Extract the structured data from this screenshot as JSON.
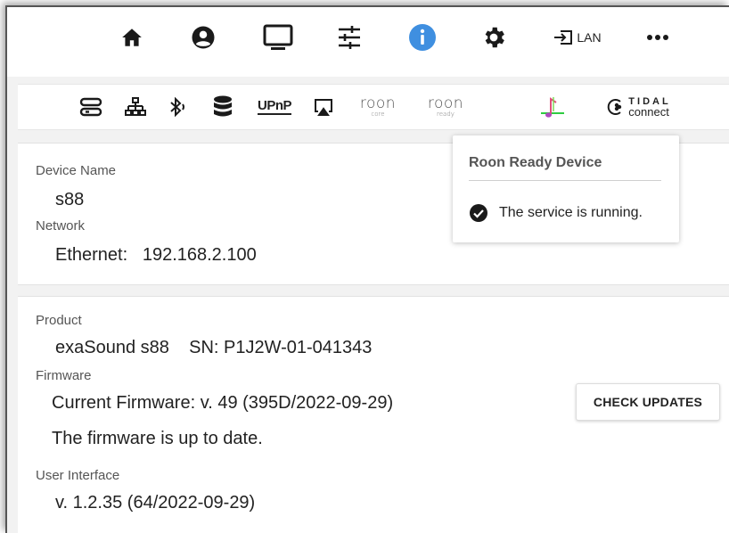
{
  "nav": {
    "icons": [
      "home-icon",
      "account-icon",
      "monitor-icon",
      "tune-icon",
      "info-icon",
      "gear-icon",
      "input-icon",
      "more-icon"
    ],
    "lan_label": "LAN",
    "accent": "#3f8fe0"
  },
  "services": {
    "upnp": "UPnP",
    "roon_core": {
      "main": "roon",
      "sub": "core"
    },
    "roon_ready": {
      "main": "roon",
      "sub": "ready"
    },
    "tidal": {
      "top": "TIDAL",
      "bottom": "connect"
    }
  },
  "device": {
    "name_label": "Device Name",
    "name_value": "s88",
    "network_label": "Network",
    "network_value": "Ethernet:   192.168.2.100"
  },
  "product": {
    "product_label": "Product",
    "product_value": "exaSound s88    SN: P1J2W-01-041343",
    "firmware_label": "Firmware",
    "firmware_current": "Current Firmware: v. 49 (395D/2022-09-29)",
    "firmware_status": "The firmware is up to date.",
    "check_button": "CHECK UPDATES",
    "ui_label": "User Interface",
    "ui_value": "v. 1.2.35 (64/2022-09-29)"
  },
  "tooltip": {
    "title": "Roon Ready Device",
    "status": "The service is running."
  }
}
